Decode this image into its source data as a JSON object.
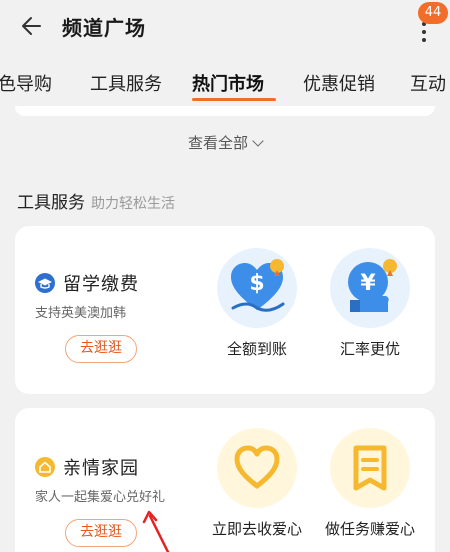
{
  "header": {
    "title": "频道广场",
    "badge": "44"
  },
  "tabs": [
    {
      "label": "色导购"
    },
    {
      "label": "工具服务"
    },
    {
      "label": "热门市场"
    },
    {
      "label": "优惠促销"
    },
    {
      "label": "互动"
    }
  ],
  "view_all": {
    "label": "查看全部"
  },
  "section": {
    "title": "工具服务",
    "subtitle": "助力轻松生活"
  },
  "cards": [
    {
      "name": "留学缴费",
      "desc": "支持英美澳加韩",
      "button": "去逛逛",
      "features": [
        {
          "label": "全额到账",
          "icon": "dollar-heart-icon"
        },
        {
          "label": "汇率更优",
          "icon": "yen-like-icon"
        }
      ]
    },
    {
      "name": "亲情家园",
      "desc": "家人一起集爱心兑好礼",
      "button": "去逛逛",
      "features": [
        {
          "label": "立即去收爱心",
          "icon": "heart-outline-icon"
        },
        {
          "label": "做任务赚爱心",
          "icon": "ribbon-list-icon"
        }
      ]
    }
  ],
  "colors": {
    "accent": "#f26d2a",
    "blue": "#3d8ee8",
    "yellow": "#f5b82e"
  }
}
